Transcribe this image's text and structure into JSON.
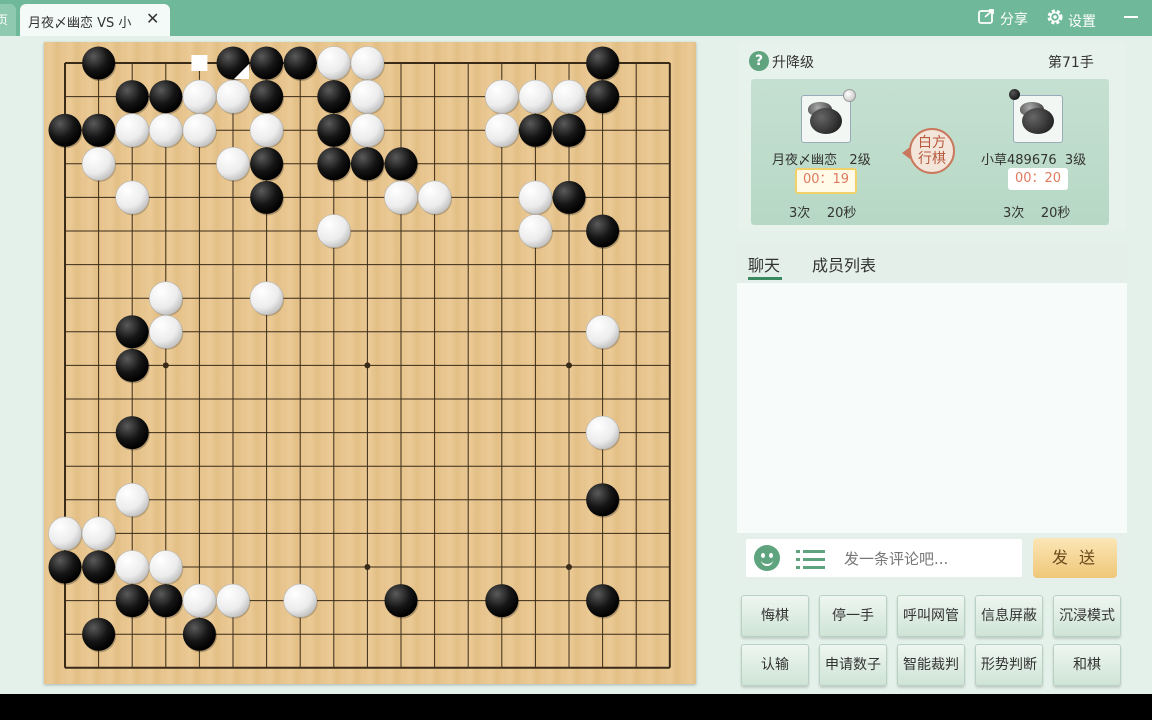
{
  "tabs": {
    "stub_label": "页",
    "active_title": "月夜〆幽恋 VS 小",
    "close_symbol": "✕"
  },
  "toolbar": {
    "share_label": "分享",
    "settings_label": "设置"
  },
  "info": {
    "upgrade_label": "升降级",
    "move_count": "第71手",
    "turn_label_line1": "白方",
    "turn_label_line2": "行棋"
  },
  "players": [
    {
      "name": "月夜〆幽恋",
      "rank": "2级",
      "clock": "00：19",
      "byoyomi_count": "3次",
      "byoyomi_time": "20秒",
      "stone": "white",
      "active": true
    },
    {
      "name": "小草489676",
      "rank": "3级",
      "clock": "00：20",
      "byoyomi_count": "3次",
      "byoyomi_time": "20秒",
      "stone": "black",
      "active": false
    }
  ],
  "chat": {
    "tab_chat": "聊天",
    "tab_members": "成员列表",
    "placeholder": "发一条评论吧...",
    "send_label": "发 送"
  },
  "actions": [
    [
      "悔棋",
      "停一手",
      "呼叫网管",
      "信息屏蔽",
      "沉浸模式"
    ],
    [
      "认输",
      "申请数子",
      "智能裁判",
      "形势判断",
      "和棋"
    ]
  ],
  "colors": {
    "accent": "#5fa47e",
    "board": "#e7c48d",
    "clock_text": "#e07a5f",
    "header": "#6fb89a"
  },
  "board": {
    "size": 19,
    "star_points": [
      [
        3,
        9
      ],
      [
        9,
        9
      ],
      [
        15,
        9
      ],
      [
        3,
        15
      ],
      [
        9,
        15
      ],
      [
        15,
        15
      ]
    ],
    "black": [
      [
        1,
        0
      ],
      [
        5,
        0
      ],
      [
        6,
        0
      ],
      [
        7,
        0
      ],
      [
        16,
        0
      ],
      [
        2,
        1
      ],
      [
        3,
        1
      ],
      [
        6,
        1
      ],
      [
        8,
        1
      ],
      [
        16,
        1
      ],
      [
        0,
        2
      ],
      [
        1,
        2
      ],
      [
        8,
        2
      ],
      [
        14,
        2
      ],
      [
        15,
        2
      ],
      [
        6,
        3
      ],
      [
        8,
        3
      ],
      [
        9,
        3
      ],
      [
        10,
        3
      ],
      [
        6,
        4
      ],
      [
        15,
        4
      ],
      [
        16,
        5
      ],
      [
        2,
        8
      ],
      [
        2,
        9
      ],
      [
        2,
        11
      ],
      [
        16,
        13
      ],
      [
        0,
        15
      ],
      [
        1,
        15
      ],
      [
        2,
        16
      ],
      [
        3,
        16
      ],
      [
        10,
        16
      ],
      [
        13,
        16
      ],
      [
        16,
        16
      ],
      [
        1,
        17
      ],
      [
        4,
        17
      ]
    ],
    "white": [
      [
        8,
        0
      ],
      [
        9,
        0
      ],
      [
        4,
        1
      ],
      [
        5,
        1
      ],
      [
        9,
        1
      ],
      [
        13,
        1
      ],
      [
        14,
        1
      ],
      [
        15,
        1
      ],
      [
        2,
        2
      ],
      [
        3,
        2
      ],
      [
        4,
        2
      ],
      [
        6,
        2
      ],
      [
        9,
        2
      ],
      [
        13,
        2
      ],
      [
        1,
        3
      ],
      [
        5,
        3
      ],
      [
        2,
        4
      ],
      [
        10,
        4
      ],
      [
        11,
        4
      ],
      [
        14,
        4
      ],
      [
        8,
        5
      ],
      [
        14,
        5
      ],
      [
        3,
        7
      ],
      [
        6,
        7
      ],
      [
        3,
        8
      ],
      [
        16,
        8
      ],
      [
        16,
        11
      ],
      [
        2,
        13
      ],
      [
        0,
        14
      ],
      [
        1,
        14
      ],
      [
        2,
        15
      ],
      [
        3,
        15
      ],
      [
        4,
        16
      ],
      [
        5,
        16
      ],
      [
        7,
        16
      ]
    ],
    "last_move": [
      5,
      0
    ],
    "territory_marker": [
      4,
      0
    ]
  }
}
